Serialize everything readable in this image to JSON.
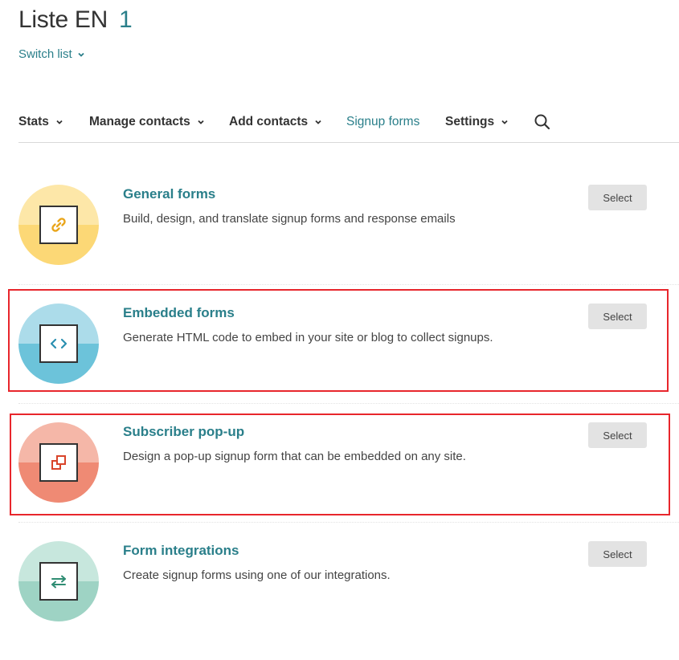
{
  "header": {
    "title": "Liste EN",
    "count": "1",
    "switch_label": "Switch list"
  },
  "nav": {
    "items": [
      {
        "label": "Stats",
        "has_dropdown": true,
        "active": false
      },
      {
        "label": "Manage contacts",
        "has_dropdown": true,
        "active": false
      },
      {
        "label": "Add contacts",
        "has_dropdown": true,
        "active": false
      },
      {
        "label": "Signup forms",
        "has_dropdown": false,
        "active": true
      },
      {
        "label": "Settings",
        "has_dropdown": true,
        "active": false
      }
    ],
    "search_icon": "search-icon"
  },
  "forms": [
    {
      "title": "General forms",
      "description": "Build, design, and translate signup forms and response emails",
      "button": "Select",
      "icon": "link-icon",
      "color_top": "#fde7a8",
      "color_bottom": "#fcd876",
      "highlighted": false
    },
    {
      "title": "Embedded forms",
      "description": "Generate HTML code to embed in your site or blog to collect signups.",
      "button": "Select",
      "icon": "code-icon",
      "color_top": "#acdcea",
      "color_bottom": "#6cc3da",
      "highlighted": true
    },
    {
      "title": "Subscriber pop-up",
      "description": "Design a pop-up signup form that can be embedded on any site.",
      "button": "Select",
      "icon": "popup-icon",
      "color_top": "#f5b7a8",
      "color_bottom": "#ef8a74",
      "highlighted": true
    },
    {
      "title": "Form integrations",
      "description": "Create signup forms using one of our integrations.",
      "button": "Select",
      "icon": "arrows-exchange-icon",
      "color_top": "#c7e7dd",
      "color_bottom": "#9ed3c4",
      "highlighted": false
    }
  ],
  "colors": {
    "accent": "#2a7f8a",
    "highlight_border": "#e8262c"
  }
}
